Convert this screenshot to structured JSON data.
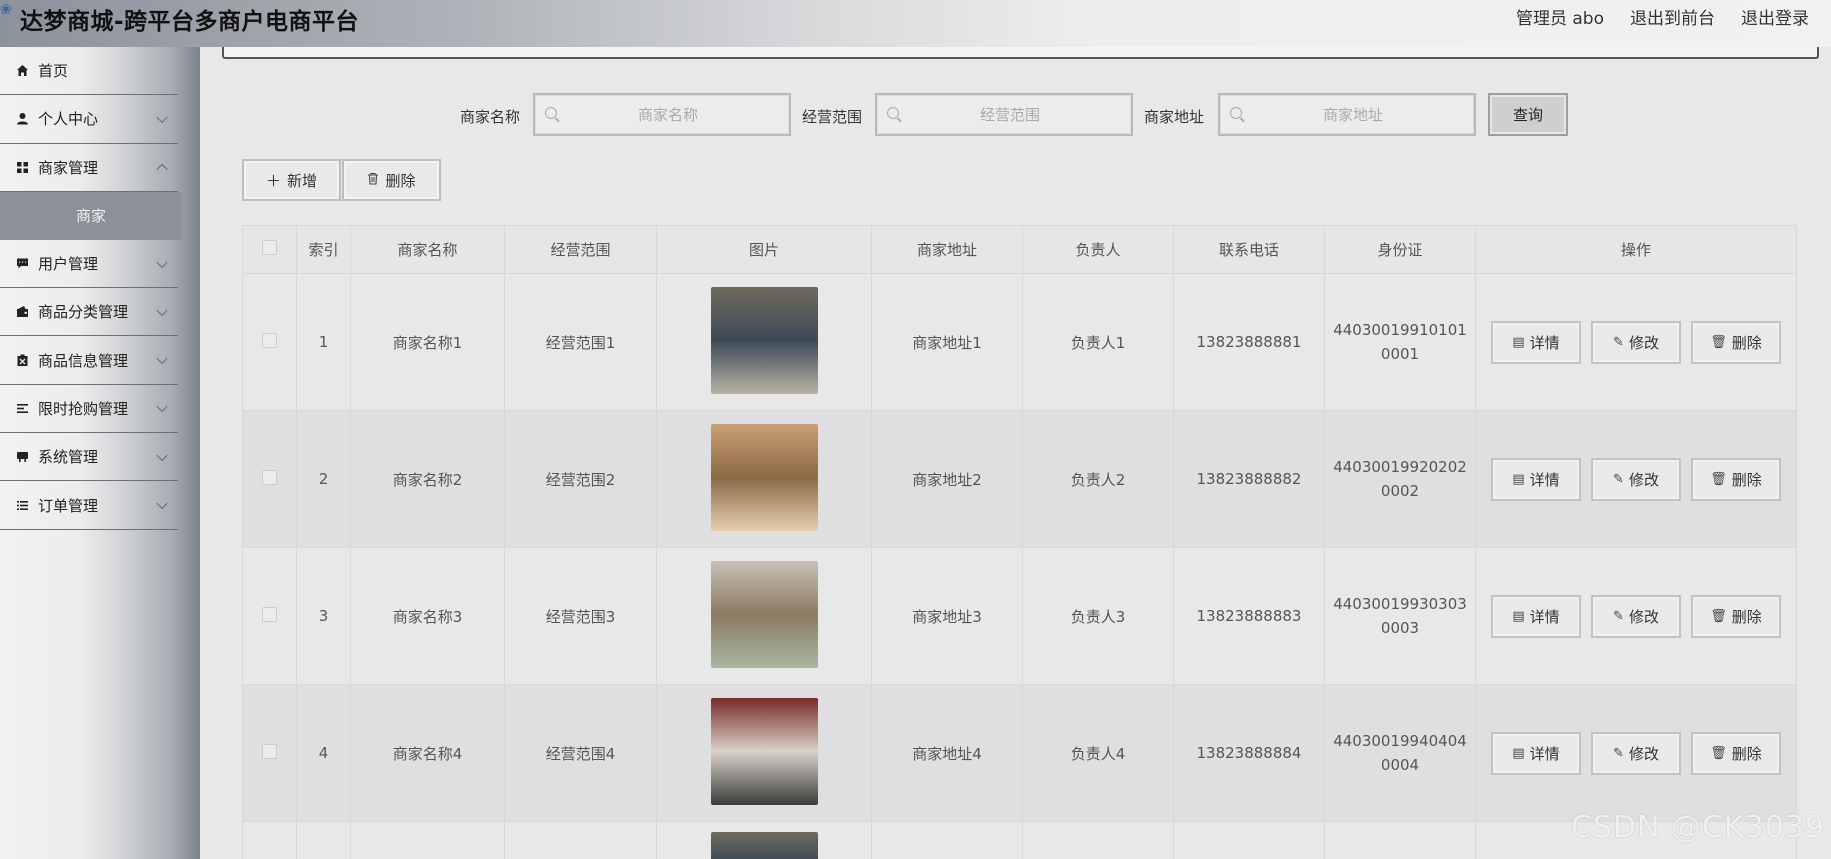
{
  "header": {
    "title": "达梦商城-跨平台多商户电商平台",
    "admin": "管理员 abo",
    "exit_front": "退出到前台",
    "logout": "退出登录"
  },
  "sidebar": {
    "items": [
      {
        "label": "首页",
        "icon": "home-icon",
        "expandable": false
      },
      {
        "label": "个人中心",
        "icon": "user-icon",
        "expandable": true
      },
      {
        "label": "商家管理",
        "icon": "grid-icon",
        "expandable": true
      },
      {
        "label": "用户管理",
        "icon": "chat-icon",
        "expandable": true
      },
      {
        "label": "商品分类管理",
        "icon": "wallet-icon",
        "expandable": true
      },
      {
        "label": "商品信息管理",
        "icon": "box-icon",
        "expandable": true
      },
      {
        "label": "限时抢购管理",
        "icon": "list-icon",
        "expandable": true
      },
      {
        "label": "系统管理",
        "icon": "printer-icon",
        "expandable": true
      },
      {
        "label": "订单管理",
        "icon": "order-list-icon",
        "expandable": true
      }
    ],
    "active_sub": "商家"
  },
  "search": {
    "name_label": "商家名称",
    "name_placeholder": "商家名称",
    "scope_label": "经营范围",
    "scope_placeholder": "经营范围",
    "address_label": "商家地址",
    "address_placeholder": "商家地址",
    "query_label": "查询"
  },
  "actions": {
    "add_label": "新增",
    "delete_label": "删除"
  },
  "table": {
    "headers": [
      "索引",
      "商家名称",
      "经营范围",
      "图片",
      "商家地址",
      "负责人",
      "联系电话",
      "身份证",
      "操作"
    ],
    "op_labels": {
      "detail": "详情",
      "edit": "修改",
      "delete": "删除"
    },
    "rows": [
      {
        "index": "1",
        "name": "商家名称1",
        "scope": "经营范围1",
        "address": "商家地址1",
        "manager": "负责人1",
        "phone": "13823888881",
        "id_line1": "44030019910101",
        "id_line2": "0001",
        "thumb_colors": [
          "#6f6a5e",
          "#3d4a56",
          "#b9b2a4"
        ]
      },
      {
        "index": "2",
        "name": "商家名称2",
        "scope": "经营范围2",
        "address": "商家地址2",
        "manager": "负责人2",
        "phone": "13823888882",
        "id_line1": "44030019920202",
        "id_line2": "0002",
        "thumb_colors": [
          "#c9a074",
          "#8b6a45",
          "#e4cfae"
        ]
      },
      {
        "index": "3",
        "name": "商家名称3",
        "scope": "经营范围3",
        "address": "商家地址3",
        "manager": "负责人3",
        "phone": "13823888883",
        "id_line1": "44030019930303",
        "id_line2": "0003",
        "thumb_colors": [
          "#c7c2b5",
          "#8c7a63",
          "#a9b8a1"
        ]
      },
      {
        "index": "4",
        "name": "商家名称4",
        "scope": "经营范围4",
        "address": "商家地址4",
        "manager": "负责人4",
        "phone": "13823888884",
        "id_line1": "44030019940404",
        "id_line2": "0004",
        "thumb_colors": [
          "#7a2a26",
          "#d8d2c8",
          "#3b3b3b"
        ]
      }
    ]
  },
  "watermark": "CSDN @CK3039",
  "colors": {
    "sidebar_submenu": "#8b9099",
    "row_alt": "#dfdfe2"
  }
}
